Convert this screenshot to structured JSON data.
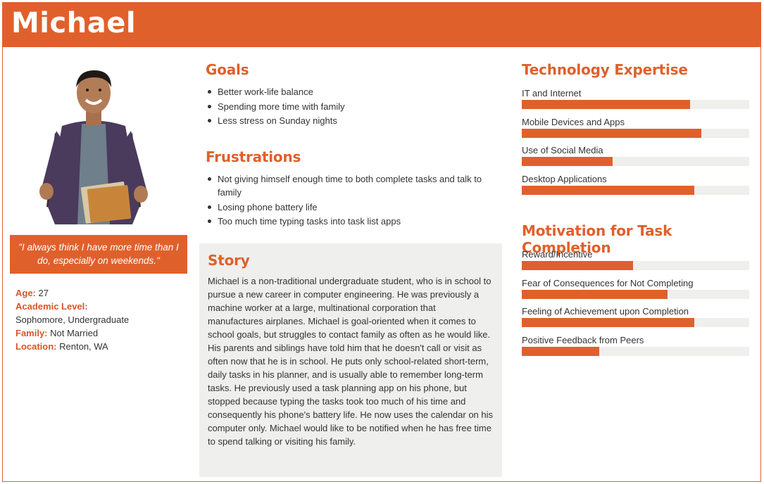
{
  "persona": {
    "name": "Michael",
    "quote": "\"I always think I have more time than I do, especially on weekends.\"",
    "facts": {
      "age_label": "Age:",
      "age_value": "27",
      "level_label": "Academic Level:",
      "level_value": "Sophomore, Undergraduate",
      "family_label": "Family:",
      "family_value": "Not Married",
      "location_label": "Location:",
      "location_value": "Renton, WA"
    }
  },
  "goals": {
    "title": "Goals",
    "items": [
      "Better work-life balance",
      "Spending more time with family",
      "Less stress on Sunday nights"
    ]
  },
  "frustrations": {
    "title": "Frustrations",
    "items": [
      "Not giving himself enough time to both complete tasks and talk to family",
      "Losing phone battery life",
      "Too much time typing tasks into task list apps"
    ]
  },
  "story": {
    "title": "Story",
    "text": "Michael is a non-traditional undergraduate student, who is in school to pursue a new career in computer engineering. He was previously a machine worker at a large, multinational corporation that manufactures airplanes. Michael is goal-oriented when it comes to school goals, but struggles to contact family as often as he would like. His parents and siblings have told him that he doesn't call or visit as often now that he is in school. He puts only school-related short-term, daily tasks in his planner, and is usually able to remember long-term tasks. He previously used a task planning app on his phone, but stopped because typing the tasks took too much of his time and consequently his phone's battery life. He now uses the calendar on his computer only. Michael would like to be notified when he has free time to spend talking or visiting his family."
  },
  "technology": {
    "title": "Technology Expertise",
    "items": [
      {
        "label": "IT and Internet",
        "level": 0.74
      },
      {
        "label": "Mobile Devices and Apps",
        "level": 0.79
      },
      {
        "label": "Use of Social Media",
        "level": 0.4
      },
      {
        "label": "Desktop Applications",
        "level": 0.76
      }
    ]
  },
  "motivation": {
    "title": "Motivation for Task Completion",
    "items": [
      {
        "label": "Reward/Incentive",
        "level": 0.49
      },
      {
        "label": "Fear of Consequences for Not Completing",
        "level": 0.64
      },
      {
        "label": "Feeling of Achievement upon Completion",
        "level": 0.76
      },
      {
        "label": "Positive Feedback from Peers",
        "level": 0.34
      }
    ]
  },
  "colors": {
    "accent": "#e0602c",
    "track": "#efefee",
    "story_bg": "#efefed"
  }
}
